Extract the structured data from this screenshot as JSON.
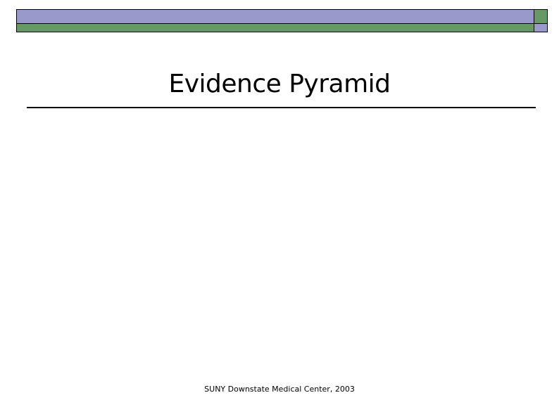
{
  "slide": {
    "title": "Evidence Pyramid",
    "footer": "SUNY Downstate Medical Center, 2003"
  },
  "colors": {
    "bar_purple": "#9999cc",
    "bar_green": "#669966",
    "border": "#000000",
    "background": "#ffffff"
  }
}
